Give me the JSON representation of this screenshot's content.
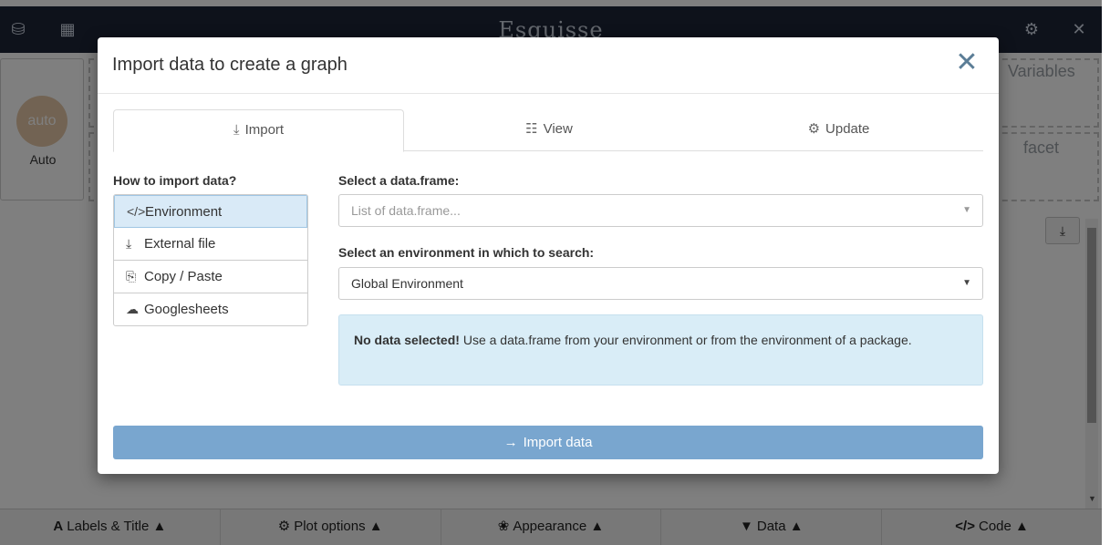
{
  "app": {
    "title": "Esquisse",
    "top_icons": {
      "database": "database-icon",
      "table": "table-icon",
      "settings": "gear-icon",
      "close": "close-icon"
    }
  },
  "background": {
    "geom_label": "Auto",
    "geom_badge": "auto",
    "variables_label": "Variables",
    "facet_label": "facet"
  },
  "bottom_bar": {
    "items": [
      {
        "label": "Labels & Title",
        "icon": "A",
        "caret": "▲"
      },
      {
        "label": "Plot options",
        "icon": "⚙",
        "caret": "▲"
      },
      {
        "label": "Appearance",
        "icon": "❀",
        "caret": "▲"
      },
      {
        "label": "Data",
        "icon": "▼",
        "caret": "▲"
      },
      {
        "label": "Code",
        "icon": "</>",
        "caret": "▲"
      }
    ]
  },
  "modal": {
    "title": "Import data to create a graph",
    "close_glyph": "✕",
    "tabs": [
      {
        "label": "Import",
        "icon": "⤓"
      },
      {
        "label": "View",
        "icon": "☷"
      },
      {
        "label": "Update",
        "icon": "⚙"
      }
    ],
    "how_label": "How to import data?",
    "methods": [
      {
        "label": "Environment",
        "icon": "</>"
      },
      {
        "label": "External file",
        "icon": "⤓"
      },
      {
        "label": "Copy / Paste",
        "icon": "⎘"
      },
      {
        "label": "Googlesheets",
        "icon": "☁"
      }
    ],
    "dataframe_label": "Select a data.frame:",
    "dataframe_placeholder": "List of data.frame...",
    "env_label": "Select an environment in which to search:",
    "env_value": "Global Environment",
    "alert_bold": "No data selected!",
    "alert_text": " Use a data.frame from your environment or from the environment of a package.",
    "import_button": "Import data",
    "import_icon": "→"
  },
  "colors": {
    "topbar": "#1c2436",
    "accent": "#79a6cf",
    "alert_bg": "#d9edf7",
    "active_item_bg": "#d9eaf7"
  }
}
